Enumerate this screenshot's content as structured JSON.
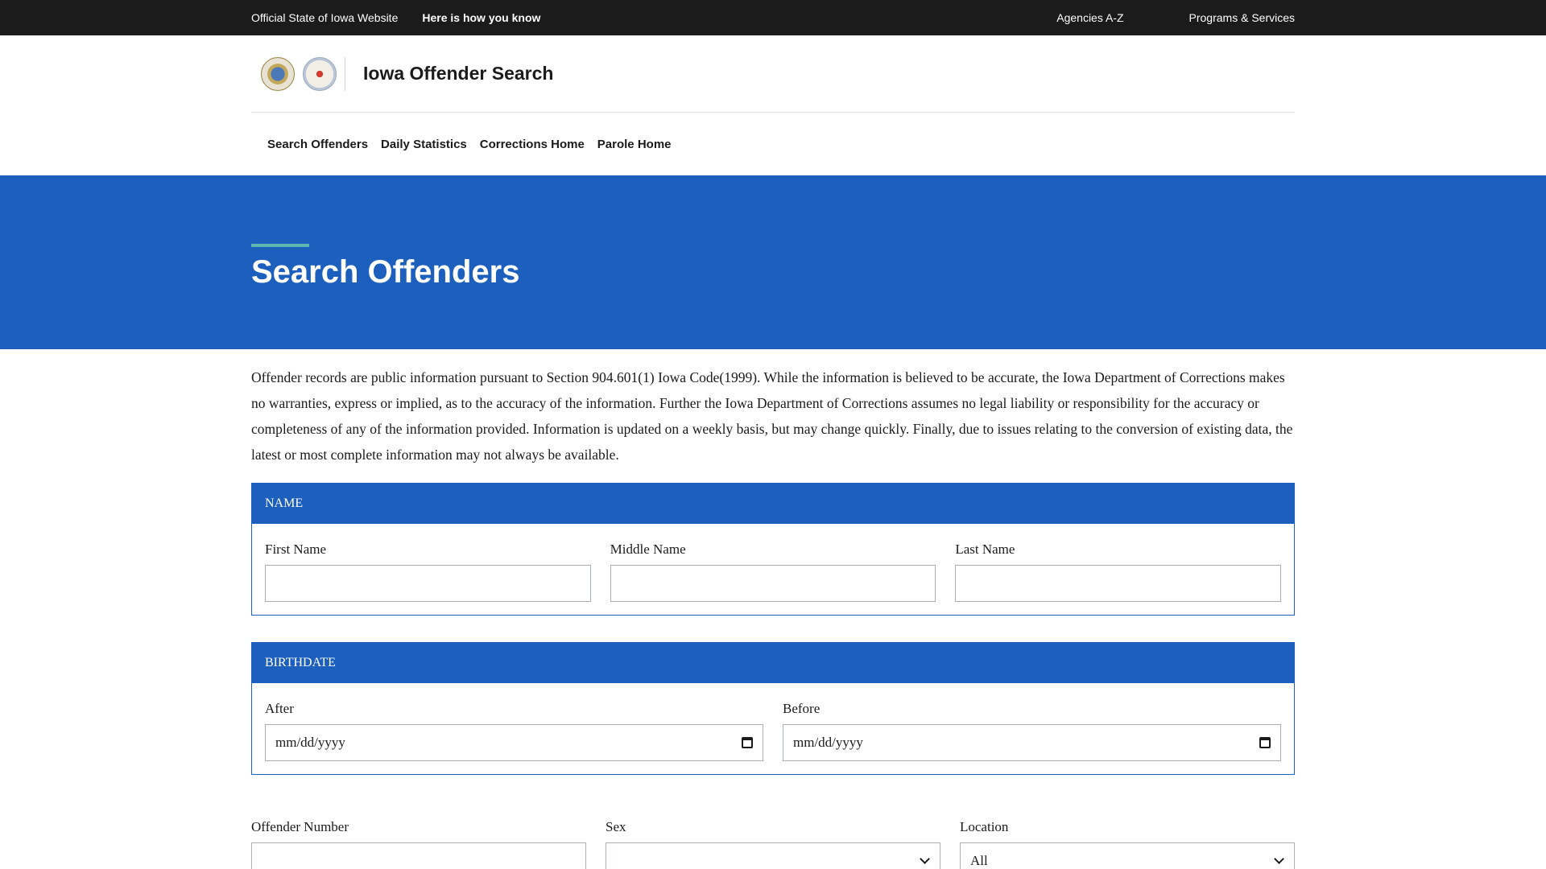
{
  "topbar": {
    "official": "Official State of Iowa Website",
    "how_you_know": "Here is how you know",
    "agencies": "Agencies A-Z",
    "programs": "Programs & Services"
  },
  "header": {
    "title": "Iowa Offender Search"
  },
  "nav": {
    "items": [
      "Search Offenders",
      "Daily Statistics",
      "Corrections Home",
      "Parole Home"
    ]
  },
  "hero": {
    "title": "Search Offenders"
  },
  "disclaimer": "Offender records are public information pursuant to Section 904.601(1) Iowa Code(1999). While the information is believed to be accurate, the Iowa Department of Corrections makes no warranties, express or implied, as to the accuracy of the information. Further the Iowa Department of Corrections assumes no legal liability or responsibility for the accuracy or completeness of any of the information provided. Information is updated on a weekly basis, but may change quickly. Finally, due to issues relating to the conversion of existing data, the latest or most complete information may not always be available.",
  "name_section": {
    "heading": "NAME",
    "first_label": "First Name",
    "middle_label": "Middle Name",
    "last_label": "Last Name",
    "first_value": "",
    "middle_value": "",
    "last_value": ""
  },
  "birthdate_section": {
    "heading": "BIRTHDATE",
    "after_label": "After",
    "before_label": "Before",
    "after_placeholder": "mm/dd/yyyy",
    "before_placeholder": "mm/dd/yyyy"
  },
  "filters": {
    "offender_number_label": "Offender Number",
    "offender_number_value": "",
    "sex_label": "Sex",
    "sex_value": "",
    "location_label": "Location",
    "location_value": "All"
  },
  "colors": {
    "topbar": "#1b1b1b",
    "primary_blue": "#1c5fbd",
    "accent_teal": "#5fb6b1"
  }
}
